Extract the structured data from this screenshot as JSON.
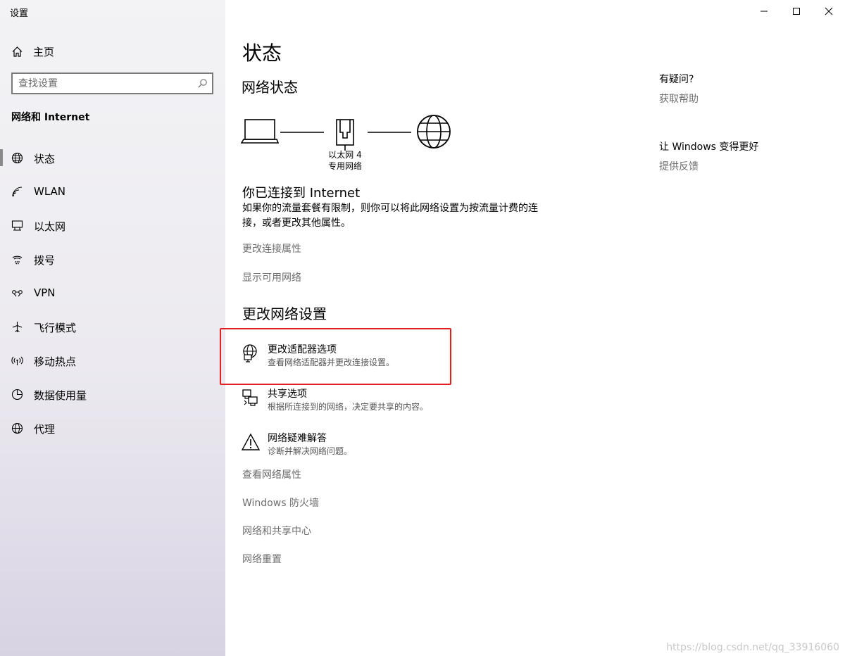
{
  "window": {
    "title": "设置",
    "controls": {
      "minimize": "minimize-icon",
      "maximize": "maximize-icon",
      "close": "close-icon"
    }
  },
  "sidebar": {
    "home_label": "主页",
    "search_placeholder": "查找设置",
    "section_title": "网络和 Internet",
    "items": [
      {
        "label": "状态",
        "icon": "globe-status-icon",
        "active": true
      },
      {
        "label": "WLAN",
        "icon": "wifi-icon"
      },
      {
        "label": "以太网",
        "icon": "ethernet-icon"
      },
      {
        "label": "拨号",
        "icon": "dialup-icon"
      },
      {
        "label": "VPN",
        "icon": "vpn-icon"
      },
      {
        "label": "飞行模式",
        "icon": "airplane-icon"
      },
      {
        "label": "移动热点",
        "icon": "hotspot-icon"
      },
      {
        "label": "数据使用量",
        "icon": "data-usage-icon"
      },
      {
        "label": "代理",
        "icon": "globe-icon"
      }
    ]
  },
  "main": {
    "page_title": "状态",
    "network_status_heading": "网络状态",
    "adapter_name": "以太网 4",
    "network_type": "专用网络",
    "connected_title": "你已连接到 Internet",
    "connected_desc": "如果你的流量套餐有限制，则你可以将此网络设置为按流量计费的连接，或者更改其他属性。",
    "links_top": [
      "更改连接属性",
      "显示可用网络"
    ],
    "change_settings_heading": "更改网络设置",
    "options": [
      {
        "title": "更改适配器选项",
        "desc": "查看网络适配器并更改连接设置。",
        "icon": "adapter-globe-icon"
      },
      {
        "title": "共享选项",
        "desc": "根据所连接到的网络，决定要共享的内容。",
        "icon": "sharing-icon"
      },
      {
        "title": "网络疑难解答",
        "desc": "诊断并解决网络问题。",
        "icon": "warning-icon"
      }
    ],
    "links_bottom": [
      "查看网络属性",
      "Windows 防火墙",
      "网络和共享中心",
      "网络重置"
    ]
  },
  "right_panel": {
    "question_heading": "有疑问?",
    "help_link": "获取帮助",
    "improve_heading": "让 Windows 变得更好",
    "feedback_link": "提供反馈"
  },
  "watermark": "https://blog.csdn.net/qq_33916060",
  "colors": {
    "highlight": "#e02020",
    "link": "#6e6e6e"
  }
}
